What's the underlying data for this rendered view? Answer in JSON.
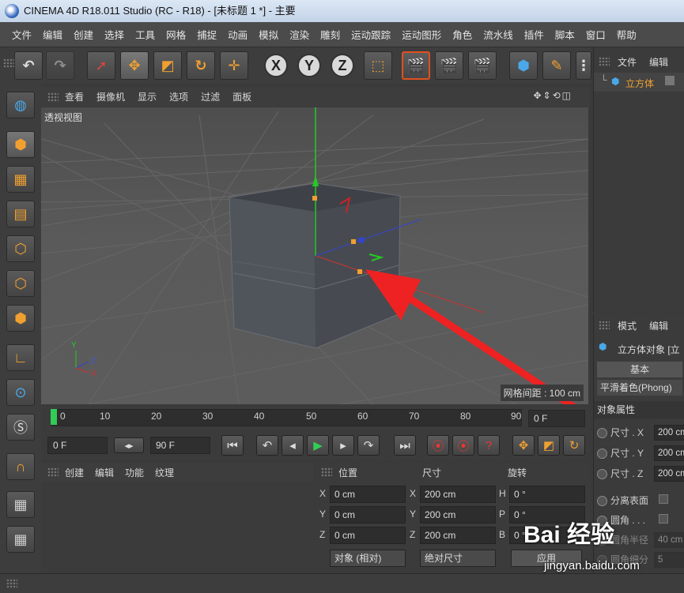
{
  "window": {
    "title": "CINEMA 4D R18.011 Studio (RC - R18) - [未标题 1 *] - 主要"
  },
  "menu": [
    "文件",
    "编辑",
    "创建",
    "选择",
    "工具",
    "网格",
    "捕捉",
    "动画",
    "模拟",
    "渲染",
    "雕刻",
    "运动跟踪",
    "运动图形",
    "角色",
    "流水线",
    "插件",
    "脚本",
    "窗口",
    "帮助"
  ],
  "toolbar": {
    "axis_x": "X",
    "axis_y": "Y",
    "axis_z": "Z"
  },
  "viewport": {
    "menu": [
      "查看",
      "摄像机",
      "显示",
      "选项",
      "过滤",
      "面板"
    ],
    "label": "透视视图",
    "grid_spacing": "网格间距 : 100 cm",
    "axis_labels": {
      "y": "Y",
      "z": "Z",
      "x": "X"
    }
  },
  "timeline": {
    "ticks": [
      "0",
      "10",
      "20",
      "30",
      "40",
      "50",
      "60",
      "70",
      "80",
      "90"
    ],
    "current_frame": "0 F"
  },
  "transport": {
    "start": "0 F",
    "end": "90 F"
  },
  "materials": {
    "menu": [
      "创建",
      "编辑",
      "功能",
      "纹理"
    ]
  },
  "coordinates": {
    "headers": {
      "position": "位置",
      "size": "尺寸",
      "rotation": "旋转"
    },
    "rows": [
      {
        "pos_label": "X",
        "pos": "0 cm",
        "size_label": "X",
        "size": "200 cm",
        "rot_label": "H",
        "rot": "0 °"
      },
      {
        "pos_label": "Y",
        "pos": "0 cm",
        "size_label": "Y",
        "size": "200 cm",
        "rot_label": "P",
        "rot": "0 °"
      },
      {
        "pos_label": "Z",
        "pos": "0 cm",
        "size_label": "Z",
        "size": "200 cm",
        "rot_label": "B",
        "rot": "0 °"
      }
    ],
    "mode": "对象 (相对)",
    "size_mode": "绝对尺寸",
    "apply": "应用"
  },
  "objects": {
    "menu": [
      "文件",
      "编辑"
    ],
    "items": [
      {
        "name": "立方体"
      }
    ]
  },
  "attributes": {
    "menu": [
      "模式",
      "编辑"
    ],
    "object_title": "立方体对象 [立",
    "tabs": [
      "基本",
      "平滑着色(Phong)"
    ],
    "section": "对象属性",
    "fields": [
      {
        "label": "尺寸 . X",
        "value": "200 cm"
      },
      {
        "label": "尺寸 . Y",
        "value": "200 cm"
      },
      {
        "label": "尺寸 . Z",
        "value": "200 cm"
      }
    ],
    "sep": "分离表面",
    "fillet": "圆角 . . .",
    "fillet_radius": "圆角半径",
    "fillet_radius_value": "40 cm",
    "fillet_sub": "圆角细分",
    "fillet_sub_value": "5"
  },
  "watermark": {
    "brand": "Bai 经验",
    "url": "jingyan.baidu.com"
  },
  "colors": {
    "accent": "#f0a030",
    "arrow": "#ee2222",
    "selected": "#f0a030"
  }
}
